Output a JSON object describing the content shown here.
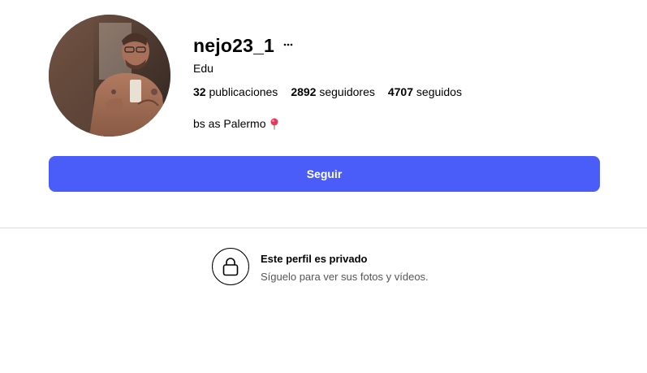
{
  "profile": {
    "username": "nejo23_1",
    "full_name": "Edu",
    "more_icon": "ellipsis-icon",
    "stats": {
      "posts_count": "32",
      "posts_label": "publicaciones",
      "followers_count": "2892",
      "followers_label": "seguidores",
      "following_count": "4707",
      "following_label": "seguidos"
    },
    "bio_text": "bs as Palermo",
    "bio_icon": "pushpin-icon"
  },
  "actions": {
    "follow_label": "Seguir"
  },
  "private_notice": {
    "title": "Este perfil es privado",
    "subtitle": "Síguelo para ver sus fotos y vídeos.",
    "icon": "lock-icon"
  },
  "colors": {
    "follow_button": "#4a5df9",
    "divider": "#dbdbdb",
    "secondary_text": "#555555"
  }
}
